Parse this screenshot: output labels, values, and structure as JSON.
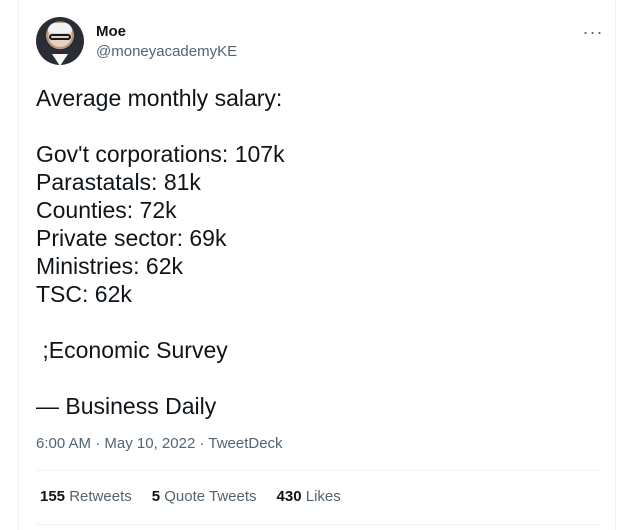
{
  "tweet": {
    "author_name": "Moe",
    "author_handle": "@moneyacademyKE",
    "more_icon": "more-horizontal-icon",
    "lines": [
      "Average monthly salary:",
      "",
      "Gov't corporations: 107k",
      "Parastatals: 81k",
      "Counties: 72k",
      "Private sector: 69k",
      "Ministries: 62k",
      "TSC: 62k",
      "",
      " ;Economic Survey",
      "",
      "— Business Daily"
    ],
    "time": "6:00 AM",
    "date": "May 10, 2022",
    "source": "TweetDeck",
    "separator": " · "
  },
  "stats": {
    "retweets_count": "155",
    "retweets_label": "Retweets",
    "quote_count": "5",
    "quote_label": "Quote Tweets",
    "likes_count": "430",
    "likes_label": "Likes"
  }
}
